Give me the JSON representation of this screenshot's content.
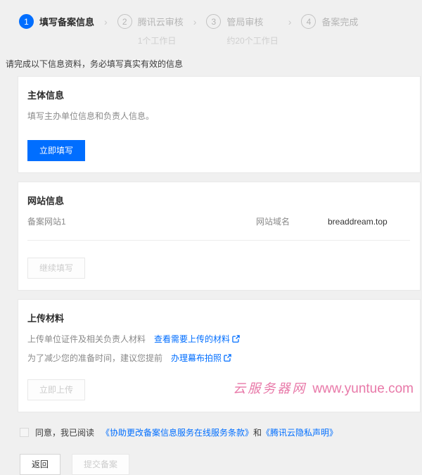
{
  "stepper": {
    "separator": "›",
    "steps": [
      {
        "number": "1",
        "label": "填写备案信息",
        "sublabel": ""
      },
      {
        "number": "2",
        "label": "腾讯云审核",
        "sublabel": "1个工作日"
      },
      {
        "number": "3",
        "label": "管局审核",
        "sublabel": "约20个工作日"
      },
      {
        "number": "4",
        "label": "备案完成",
        "sublabel": ""
      }
    ]
  },
  "notice": "请完成以下信息资料，务必填写真实有效的信息",
  "cards": {
    "subject": {
      "title": "主体信息",
      "description": "填写主办单位信息和负责人信息。",
      "button_label": "立即填写"
    },
    "website": {
      "title": "网站信息",
      "site_name": "备案网站1",
      "domain_label": "网站域名",
      "domain_value": "breaddream.top",
      "button_label": "继续填写"
    },
    "upload": {
      "title": "上传材料",
      "line1_text": "上传单位证件及相关负责人材料",
      "line1_link": "查看需要上传的材料",
      "line2_text": "为了减少您的准备时间，建议您提前",
      "line2_link": "办理幕布拍照",
      "button_label": "立即上传"
    }
  },
  "agreement": {
    "prefix": "同意，我已阅读",
    "link1": "《协助更改备案信息服务在线服务条款》",
    "conjunction": "和",
    "link2": "《腾讯云隐私声明》"
  },
  "footer": {
    "back_label": "返回",
    "submit_label": "提交备案"
  },
  "watermark": {
    "site_name": "云服务器网",
    "url": "www.yuntue.com"
  },
  "colors": {
    "accent_blue": "#006eff",
    "watermark_pink": "#e878a8",
    "page_background": "#f0f0f0"
  }
}
